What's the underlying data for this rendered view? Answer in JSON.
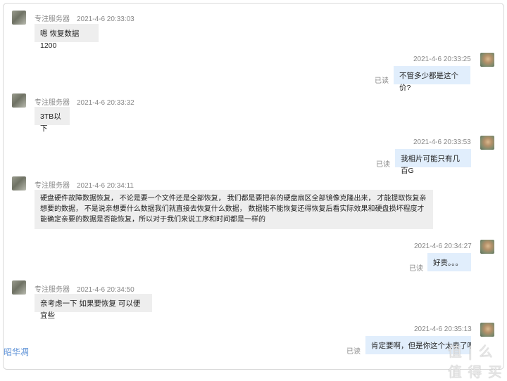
{
  "messages": [
    {
      "sender": "专注服务器",
      "time": "2021-4-6 20:33:03",
      "text": "嗯 恢复数据 1200",
      "dir": "in"
    },
    {
      "time": "2021-4-6 20:33:25",
      "text": "不管多少都是这个价?",
      "dir": "out",
      "read": "已读"
    },
    {
      "sender": "专注服务器",
      "time": "2021-4-6 20:33:32",
      "text": "3TB以下",
      "dir": "in"
    },
    {
      "time": "2021-4-6 20:33:53",
      "text": "我相片可能只有几百G",
      "dir": "out",
      "read": "已读"
    },
    {
      "sender": "专注服务器",
      "time": "2021-4-6 20:34:11",
      "text": "硬盘硬件故障数据恢复， 不论是要一个文件还是全部恢复， 我们都是要把亲的硬盘扇区全部镜像克隆出来， 才能提取恢复亲想要的数据， 不是说亲想要什么数据我们就直接去恢复什么数据， 数据能不能恢复还得恢复后看实际效果和硬盘损坏程度才能确定亲要的数据是否能恢复，所以对于我们来说工序和时间都是一样的",
      "dir": "in"
    },
    {
      "time": "2021-4-6 20:34:27",
      "text": "好贵。。。",
      "dir": "out",
      "read": "已读"
    },
    {
      "sender": "专注服务器",
      "time": "2021-4-6 20:34:50",
      "text": "亲考虑一下 如果要恢复 可以便宜些",
      "dir": "in"
    },
    {
      "time": "2021-4-6 20:35:13",
      "text": "肯定要啊，但是你这个太贵了吧",
      "dir": "out",
      "read": "已读"
    }
  ],
  "watermark_left": "昭华凋",
  "watermark_right": "值 | 么 值 得 买"
}
